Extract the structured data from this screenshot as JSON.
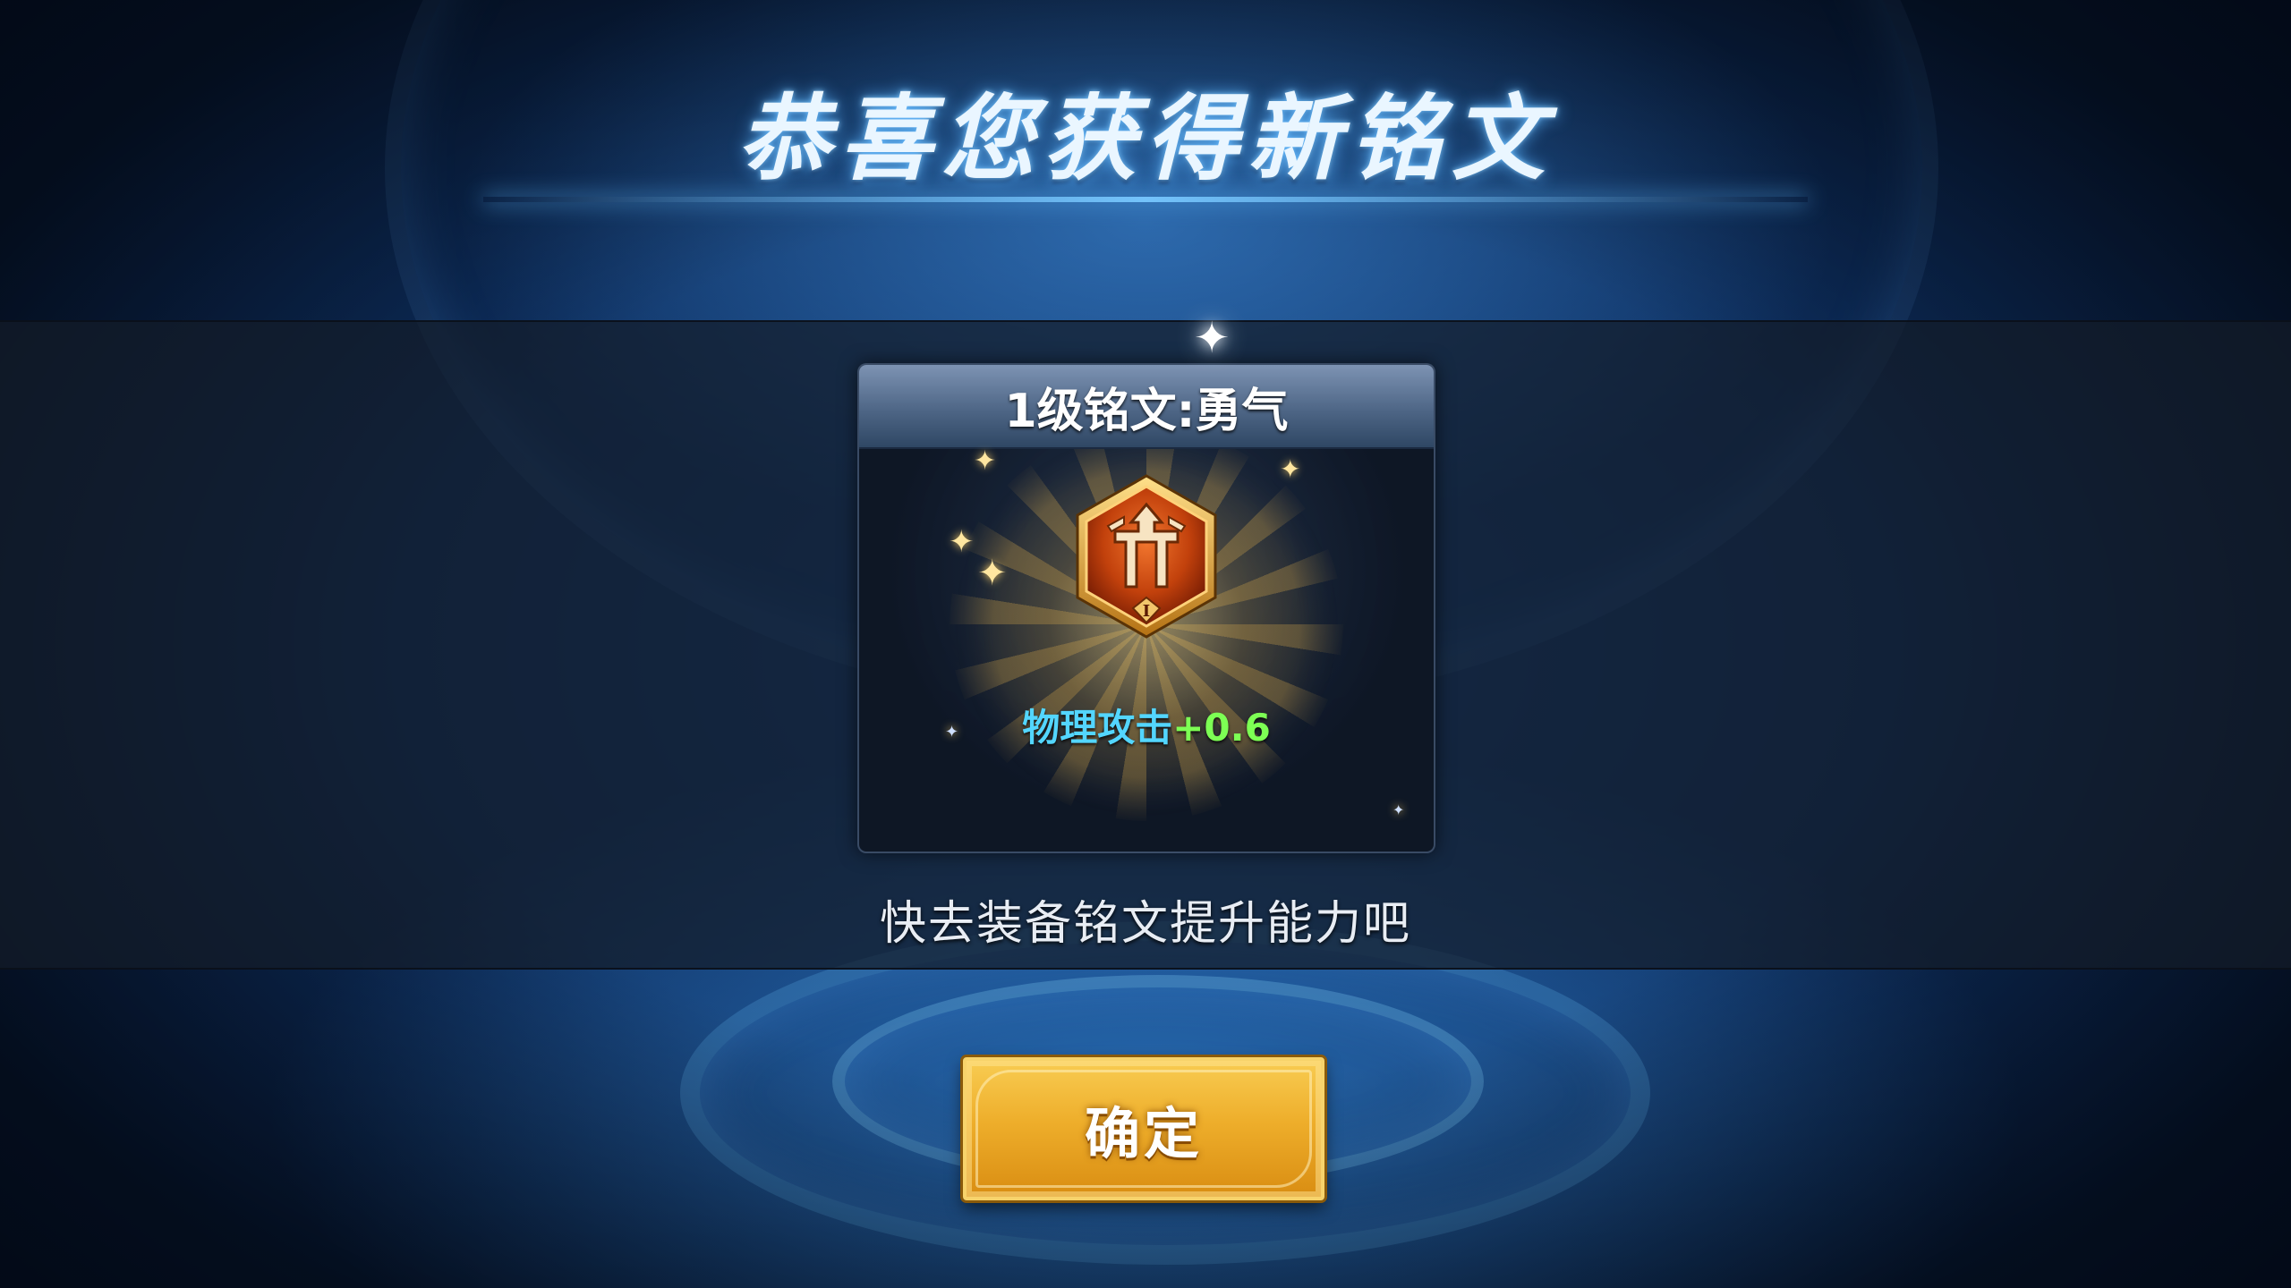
{
  "title": "恭喜您获得新铭文",
  "rune_card": {
    "name": "1级铭文:勇气",
    "level_numeral": "I",
    "stat_name": "物理攻击",
    "stat_value": "+0.6",
    "icon": "rune-emblem-icon"
  },
  "hint": "快去装备铭文提升能力吧",
  "confirm_button": {
    "label": "确定"
  },
  "colors": {
    "stat_name": "#53d6ff",
    "stat_value": "#7dff54",
    "button_gold": "#eeae2b",
    "rune_red": "#c2410c"
  }
}
